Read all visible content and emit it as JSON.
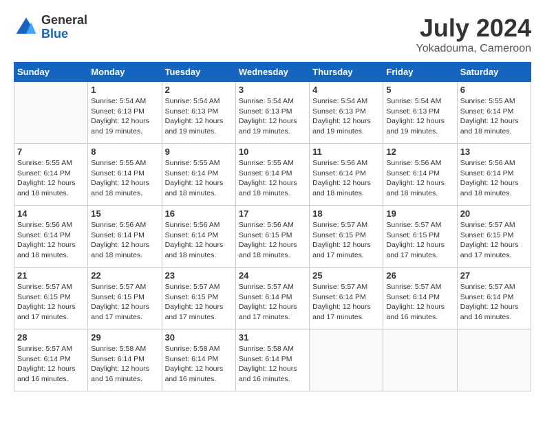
{
  "header": {
    "logo_general": "General",
    "logo_blue": "Blue",
    "month_year": "July 2024",
    "location": "Yokadouma, Cameroon"
  },
  "days_of_week": [
    "Sunday",
    "Monday",
    "Tuesday",
    "Wednesday",
    "Thursday",
    "Friday",
    "Saturday"
  ],
  "weeks": [
    [
      {
        "day": "",
        "info": ""
      },
      {
        "day": "1",
        "info": "Sunrise: 5:54 AM\nSunset: 6:13 PM\nDaylight: 12 hours\nand 19 minutes."
      },
      {
        "day": "2",
        "info": "Sunrise: 5:54 AM\nSunset: 6:13 PM\nDaylight: 12 hours\nand 19 minutes."
      },
      {
        "day": "3",
        "info": "Sunrise: 5:54 AM\nSunset: 6:13 PM\nDaylight: 12 hours\nand 19 minutes."
      },
      {
        "day": "4",
        "info": "Sunrise: 5:54 AM\nSunset: 6:13 PM\nDaylight: 12 hours\nand 19 minutes."
      },
      {
        "day": "5",
        "info": "Sunrise: 5:54 AM\nSunset: 6:13 PM\nDaylight: 12 hours\nand 19 minutes."
      },
      {
        "day": "6",
        "info": "Sunrise: 5:55 AM\nSunset: 6:14 PM\nDaylight: 12 hours\nand 18 minutes."
      }
    ],
    [
      {
        "day": "7",
        "info": "Sunrise: 5:55 AM\nSunset: 6:14 PM\nDaylight: 12 hours\nand 18 minutes."
      },
      {
        "day": "8",
        "info": "Sunrise: 5:55 AM\nSunset: 6:14 PM\nDaylight: 12 hours\nand 18 minutes."
      },
      {
        "day": "9",
        "info": "Sunrise: 5:55 AM\nSunset: 6:14 PM\nDaylight: 12 hours\nand 18 minutes."
      },
      {
        "day": "10",
        "info": "Sunrise: 5:55 AM\nSunset: 6:14 PM\nDaylight: 12 hours\nand 18 minutes."
      },
      {
        "day": "11",
        "info": "Sunrise: 5:56 AM\nSunset: 6:14 PM\nDaylight: 12 hours\nand 18 minutes."
      },
      {
        "day": "12",
        "info": "Sunrise: 5:56 AM\nSunset: 6:14 PM\nDaylight: 12 hours\nand 18 minutes."
      },
      {
        "day": "13",
        "info": "Sunrise: 5:56 AM\nSunset: 6:14 PM\nDaylight: 12 hours\nand 18 minutes."
      }
    ],
    [
      {
        "day": "14",
        "info": "Sunrise: 5:56 AM\nSunset: 6:14 PM\nDaylight: 12 hours\nand 18 minutes."
      },
      {
        "day": "15",
        "info": "Sunrise: 5:56 AM\nSunset: 6:14 PM\nDaylight: 12 hours\nand 18 minutes."
      },
      {
        "day": "16",
        "info": "Sunrise: 5:56 AM\nSunset: 6:14 PM\nDaylight: 12 hours\nand 18 minutes."
      },
      {
        "day": "17",
        "info": "Sunrise: 5:56 AM\nSunset: 6:15 PM\nDaylight: 12 hours\nand 18 minutes."
      },
      {
        "day": "18",
        "info": "Sunrise: 5:57 AM\nSunset: 6:15 PM\nDaylight: 12 hours\nand 17 minutes."
      },
      {
        "day": "19",
        "info": "Sunrise: 5:57 AM\nSunset: 6:15 PM\nDaylight: 12 hours\nand 17 minutes."
      },
      {
        "day": "20",
        "info": "Sunrise: 5:57 AM\nSunset: 6:15 PM\nDaylight: 12 hours\nand 17 minutes."
      }
    ],
    [
      {
        "day": "21",
        "info": "Sunrise: 5:57 AM\nSunset: 6:15 PM\nDaylight: 12 hours\nand 17 minutes."
      },
      {
        "day": "22",
        "info": "Sunrise: 5:57 AM\nSunset: 6:15 PM\nDaylight: 12 hours\nand 17 minutes."
      },
      {
        "day": "23",
        "info": "Sunrise: 5:57 AM\nSunset: 6:15 PM\nDaylight: 12 hours\nand 17 minutes."
      },
      {
        "day": "24",
        "info": "Sunrise: 5:57 AM\nSunset: 6:14 PM\nDaylight: 12 hours\nand 17 minutes."
      },
      {
        "day": "25",
        "info": "Sunrise: 5:57 AM\nSunset: 6:14 PM\nDaylight: 12 hours\nand 17 minutes."
      },
      {
        "day": "26",
        "info": "Sunrise: 5:57 AM\nSunset: 6:14 PM\nDaylight: 12 hours\nand 16 minutes."
      },
      {
        "day": "27",
        "info": "Sunrise: 5:57 AM\nSunset: 6:14 PM\nDaylight: 12 hours\nand 16 minutes."
      }
    ],
    [
      {
        "day": "28",
        "info": "Sunrise: 5:57 AM\nSunset: 6:14 PM\nDaylight: 12 hours\nand 16 minutes."
      },
      {
        "day": "29",
        "info": "Sunrise: 5:58 AM\nSunset: 6:14 PM\nDaylight: 12 hours\nand 16 minutes."
      },
      {
        "day": "30",
        "info": "Sunrise: 5:58 AM\nSunset: 6:14 PM\nDaylight: 12 hours\nand 16 minutes."
      },
      {
        "day": "31",
        "info": "Sunrise: 5:58 AM\nSunset: 6:14 PM\nDaylight: 12 hours\nand 16 minutes."
      },
      {
        "day": "",
        "info": ""
      },
      {
        "day": "",
        "info": ""
      },
      {
        "day": "",
        "info": ""
      }
    ]
  ]
}
